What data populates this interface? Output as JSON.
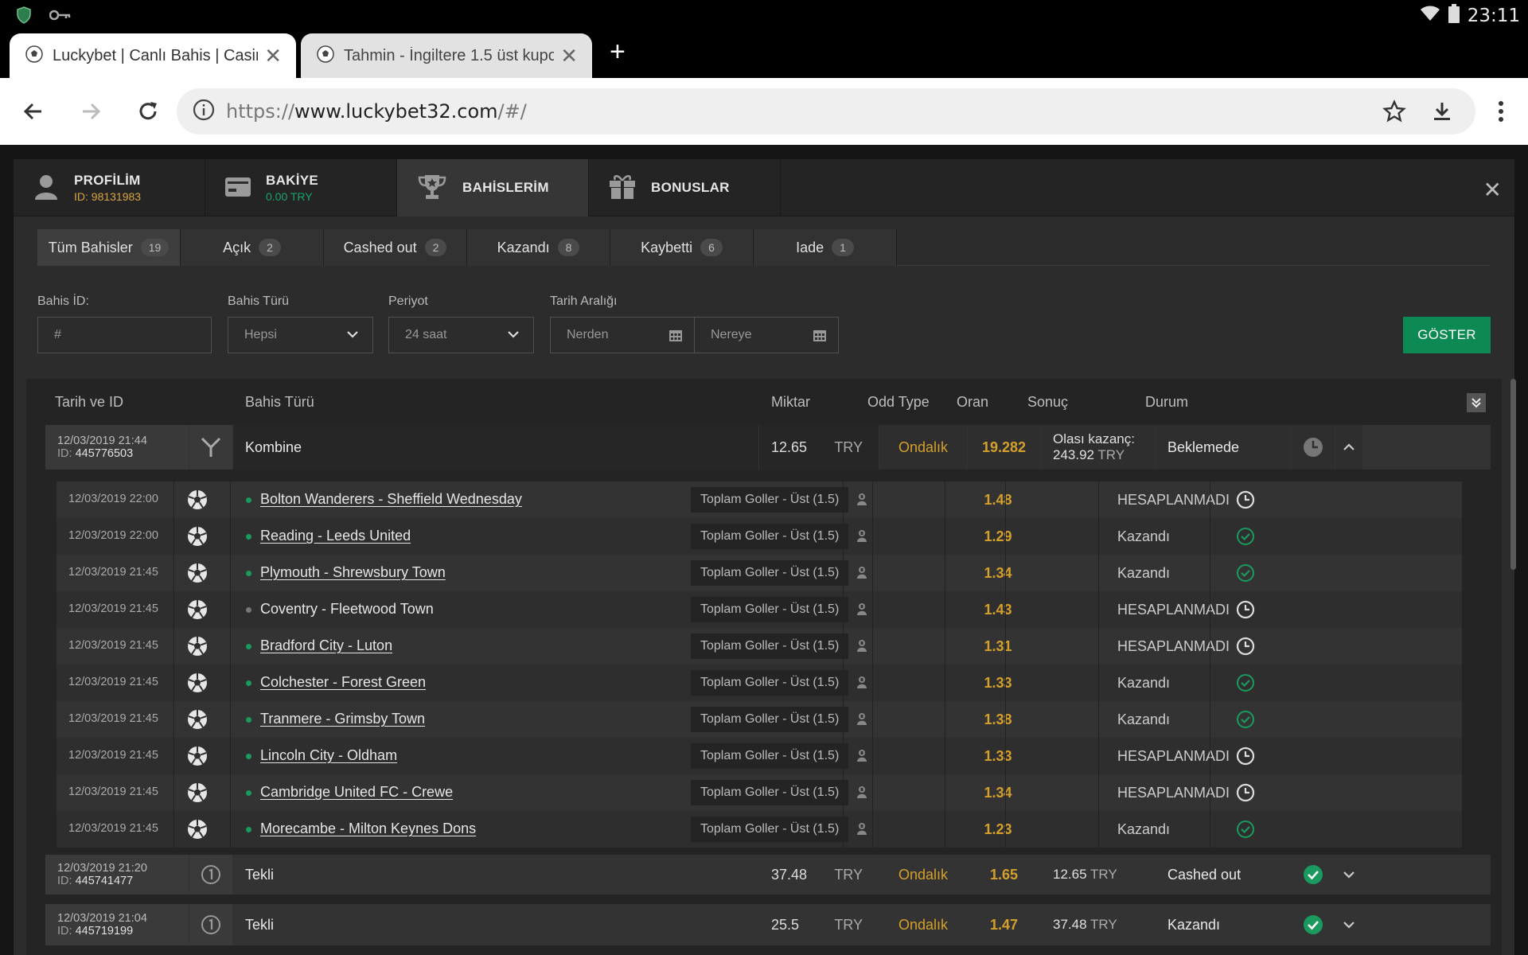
{
  "status_bar": {
    "time": "23:11"
  },
  "browser": {
    "tabs": [
      {
        "title": "Luckybet | Canlı Bahis | Casino",
        "active": true
      },
      {
        "title": "Tahmin - İngiltere 1.5 üst kupon",
        "active": false
      }
    ],
    "url_scheme": "https://",
    "url_host": "www.luckybet32.com",
    "url_path": "/#/"
  },
  "account_tabs": {
    "profile": {
      "label": "PROFİLİM",
      "sub": "ID: 98131983"
    },
    "balance": {
      "label": "BAKİYE",
      "sub": "0.00 TRY"
    },
    "bets": {
      "label": "BAHİSLERİM"
    },
    "bonuses": {
      "label": "BONUSLAR"
    }
  },
  "filter_tabs": [
    {
      "label": "Tüm Bahisler",
      "count": "19"
    },
    {
      "label": "Açık",
      "count": "2"
    },
    {
      "label": "Cashed out",
      "count": "2"
    },
    {
      "label": "Kazandı",
      "count": "8"
    },
    {
      "label": "Kaybetti",
      "count": "6"
    },
    {
      "label": "Iade",
      "count": "1"
    }
  ],
  "filters": {
    "bet_id_label": "Bahis İD:",
    "bet_id_placeholder": "#",
    "bet_type_label": "Bahis Türü",
    "bet_type_value": "Hepsi",
    "period_label": "Periyot",
    "period_value": "24 saat",
    "date_range_label": "Tarih Aralığı",
    "from_placeholder": "Nerden",
    "to_placeholder": "Nereye",
    "show_button": "GÖSTER"
  },
  "table_headers": {
    "date_id": "Tarih ve ID",
    "bet_type": "Bahis Türü",
    "amount": "Miktar",
    "odd_type": "Odd Type",
    "odds": "Oran",
    "result": "Sonuç",
    "state": "Durum"
  },
  "bets": [
    {
      "date": "12/03/2019 21:44",
      "id_prefix": "ID: ",
      "id": "445776503",
      "type": "Kombine",
      "amount": "12.65",
      "currency": "TRY",
      "odd_type": "Ondalık",
      "odds": "19.282",
      "result_line1": "Olası kazanç:",
      "result_value": "243.92",
      "result_currency": "TRY",
      "state": "Beklemede"
    },
    {
      "date": "12/03/2019 21:20",
      "id_prefix": "ID: ",
      "id": "445741477",
      "type": "Tekli",
      "amount": "37.48",
      "currency": "TRY",
      "odd_type": "Ondalık",
      "odds": "1.65",
      "result_value": "12.65",
      "result_currency": "TRY",
      "state": "Cashed out"
    },
    {
      "date": "12/03/2019 21:04",
      "id_prefix": "ID: ",
      "id": "445719199",
      "type": "Tekli",
      "amount": "25.5",
      "currency": "TRY",
      "odd_type": "Ondalık",
      "odds": "1.47",
      "result_value": "37.48",
      "result_currency": "TRY",
      "state": "Kazandı"
    }
  ],
  "selections": [
    {
      "date": "12/03/2019 22:00",
      "match": "Bolton Wanderers - Sheffield Wednesday",
      "market": "Toplam Goller - Üst (1.5)",
      "odds": "1.48",
      "state": "HESAPLANMADI",
      "status": "pending",
      "live": true
    },
    {
      "date": "12/03/2019 22:00",
      "match": "Reading - Leeds United",
      "market": "Toplam Goller - Üst (1.5)",
      "odds": "1.29",
      "state": "Kazandı",
      "status": "won",
      "live": true
    },
    {
      "date": "12/03/2019 21:45",
      "match": "Plymouth - Shrewsbury Town",
      "market": "Toplam Goller - Üst (1.5)",
      "odds": "1.34",
      "state": "Kazandı",
      "status": "won",
      "live": true
    },
    {
      "date": "12/03/2019 21:45",
      "match": "Coventry - Fleetwood Town",
      "market": "Toplam Goller - Üst (1.5)",
      "odds": "1.43",
      "state": "HESAPLANMADI",
      "status": "pending",
      "live": false
    },
    {
      "date": "12/03/2019 21:45",
      "match": "Bradford City - Luton",
      "market": "Toplam Goller - Üst (1.5)",
      "odds": "1.31",
      "state": "HESAPLANMADI",
      "status": "pending",
      "live": true
    },
    {
      "date": "12/03/2019 21:45",
      "match": "Colchester - Forest Green",
      "market": "Toplam Goller - Üst (1.5)",
      "odds": "1.33",
      "state": "Kazandı",
      "status": "won",
      "live": true
    },
    {
      "date": "12/03/2019 21:45",
      "match": "Tranmere - Grimsby Town",
      "market": "Toplam Goller - Üst (1.5)",
      "odds": "1.38",
      "state": "Kazandı",
      "status": "won",
      "live": true
    },
    {
      "date": "12/03/2019 21:45",
      "match": "Lincoln City - Oldham",
      "market": "Toplam Goller - Üst (1.5)",
      "odds": "1.33",
      "state": "HESAPLANMADI",
      "status": "pending",
      "live": true
    },
    {
      "date": "12/03/2019 21:45",
      "match": "Cambridge United FC - Crewe",
      "market": "Toplam Goller - Üst (1.5)",
      "odds": "1.34",
      "state": "HESAPLANMADI",
      "status": "pending",
      "live": true
    },
    {
      "date": "12/03/2019 21:45",
      "match": "Morecambe - Milton Keynes Dons",
      "market": "Toplam Goller - Üst (1.5)",
      "odds": "1.23",
      "state": "Kazandı",
      "status": "won",
      "live": true
    }
  ],
  "colors": {
    "accent_green": "#0d8a53",
    "odds_gold": "#d4a02c",
    "balance_green": "#1aa46a",
    "profile_id_gold": "#d9a441"
  }
}
